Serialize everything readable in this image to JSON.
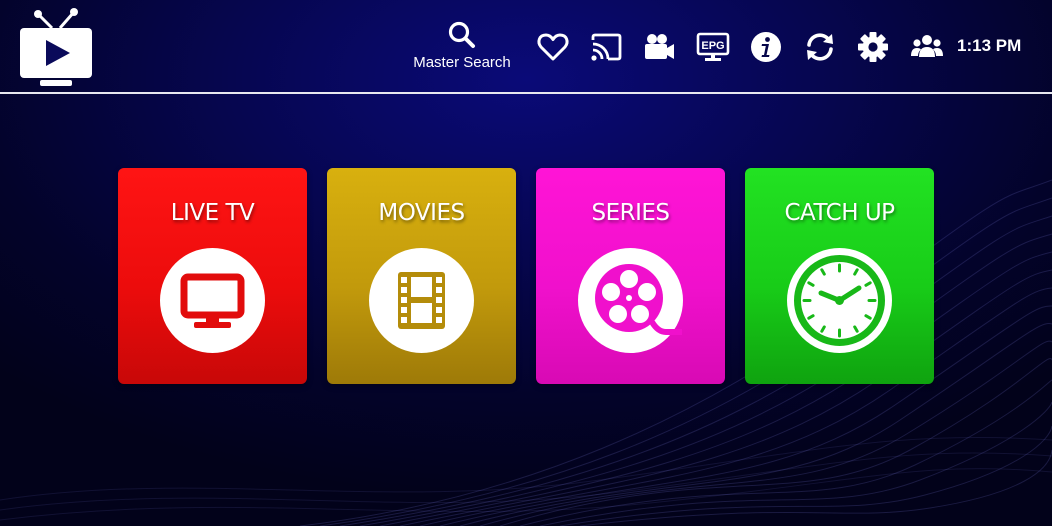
{
  "header": {
    "search_label": "Master Search",
    "time": "1:13 PM",
    "epg_label": "EPG",
    "icons": [
      "tv-logo-icon",
      "search-icon",
      "heart-icon",
      "cast-icon",
      "video-camera-icon",
      "epg-icon",
      "info-icon",
      "refresh-icon",
      "gear-icon",
      "users-icon"
    ]
  },
  "tiles": [
    {
      "label": "LIVE TV",
      "icon": "tv-monitor-icon",
      "color": "#ec0c0c"
    },
    {
      "label": "MOVIES",
      "icon": "film-strip-icon",
      "color": "#c29a0c"
    },
    {
      "label": "SERIES",
      "icon": "film-reel-icon",
      "color": "#f010cc"
    },
    {
      "label": "CATCH UP",
      "icon": "clock-icon",
      "color": "#18cc18"
    }
  ],
  "colors": {
    "background": "#060650",
    "header_line": "#e8e8f0",
    "text": "#ffffff"
  }
}
